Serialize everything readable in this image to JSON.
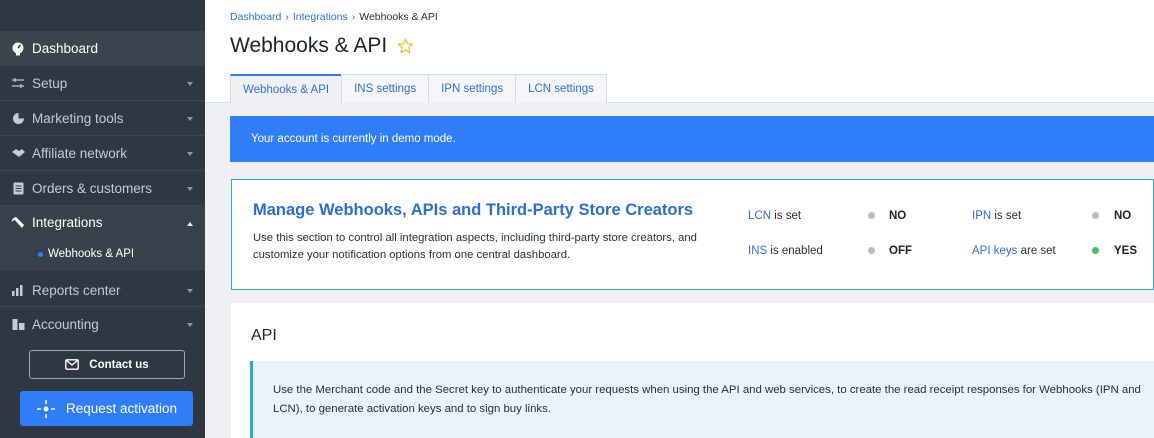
{
  "sidebar": {
    "dashboard": "Dashboard",
    "setup": "Setup",
    "marketing": "Marketing tools",
    "affiliate": "Affiliate network",
    "orders": "Orders & customers",
    "integrations": "Integrations",
    "webhooks_sub": "Webhooks & API",
    "reports": "Reports center",
    "accounting": "Accounting",
    "contact": "Contact us",
    "activate": "Request activation"
  },
  "breadcrumb": {
    "dashboard": "Dashboard",
    "integrations": "Integrations",
    "current": "Webhooks & API",
    "separator": "›"
  },
  "page": {
    "title": "Webhooks & API"
  },
  "tabs": {
    "t0": "Webhooks & API",
    "t1": "INS settings",
    "t2": "IPN settings",
    "t3": "LCN settings"
  },
  "banner": {
    "text": "Your account is currently in demo mode."
  },
  "manage": {
    "title": "Manage Webhooks, APIs and Third-Party Store Creators",
    "description": "Use this section to control all integration aspects, including third-party store creators, and customize your notification options from one central dashboard.",
    "status": {
      "lcn": {
        "key": "LCN",
        "rest": "is set",
        "value": "NO",
        "color": "#b9bec4"
      },
      "ipn": {
        "key": "IPN",
        "rest": "is set",
        "value": "NO",
        "color": "#b9bec4"
      },
      "ins": {
        "key": "INS",
        "rest": "is enabled",
        "value": "OFF",
        "color": "#b9bec4"
      },
      "api": {
        "key": "API keys",
        "rest": "are set",
        "value": "YES",
        "color": "#3cc36a"
      }
    }
  },
  "api": {
    "title": "API",
    "note": "Use the Merchant code and the Secret key to authenticate your requests when using the API and web services, to create the read receipt responses for Webhooks (IPN and LCN), to generate activation keys and to sign buy links."
  },
  "colors": {
    "sidebar_bg": "#2e3842",
    "accent": "#2f7df8",
    "link": "#2f6fd6",
    "card_border": "#2aa5e6",
    "star": "#f2b71f"
  }
}
